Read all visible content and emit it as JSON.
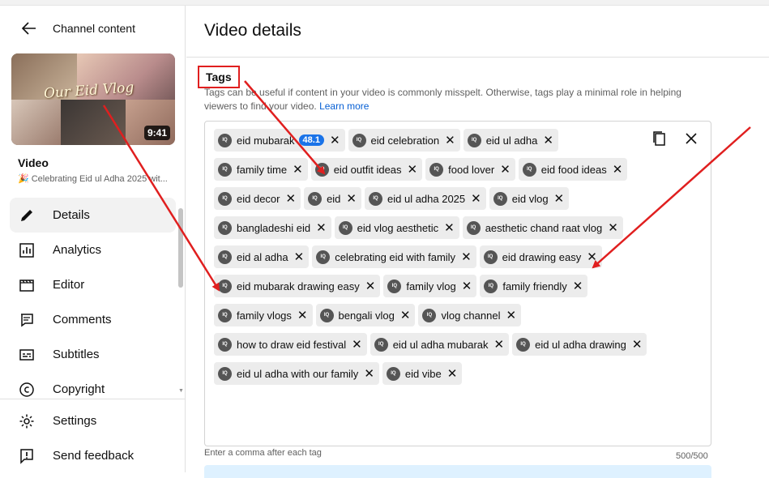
{
  "sidebar": {
    "title": "Channel content",
    "thumbnail": {
      "overlay_text": "Our Eid Vlog",
      "duration": "9:41"
    },
    "video_label": "Video",
    "video_title": "Celebrating Eid ul Adha 2025 wit...",
    "nav": [
      {
        "label": "Details",
        "icon": "pencil-icon",
        "active": true
      },
      {
        "label": "Analytics",
        "icon": "analytics-icon"
      },
      {
        "label": "Editor",
        "icon": "editor-icon"
      },
      {
        "label": "Comments",
        "icon": "comments-icon"
      },
      {
        "label": "Subtitles",
        "icon": "subtitles-icon"
      },
      {
        "label": "Copyright",
        "icon": "copyright-icon"
      }
    ],
    "bottom": [
      {
        "label": "Settings",
        "icon": "gear-icon"
      },
      {
        "label": "Send feedback",
        "icon": "feedback-icon"
      }
    ]
  },
  "main": {
    "title": "Video details",
    "tags_label": "Tags",
    "tags_desc": "Tags can be useful if content in your video is commonly misspelt. Otherwise, tags play a minimal role in helping viewers to find your video.",
    "learn_more": "Learn more",
    "tags": [
      {
        "label": "eid mubarak",
        "score": "48.1"
      },
      {
        "label": "eid celebration"
      },
      {
        "label": "eid ul adha"
      },
      {
        "label": "family time"
      },
      {
        "label": "eid outfit ideas"
      },
      {
        "label": "food lover"
      },
      {
        "label": "eid food ideas"
      },
      {
        "label": "eid decor"
      },
      {
        "label": "eid"
      },
      {
        "label": "eid ul adha 2025"
      },
      {
        "label": "eid vlog"
      },
      {
        "label": "bangladeshi eid"
      },
      {
        "label": "eid vlog aesthetic"
      },
      {
        "label": "aesthetic chand raat vlog"
      },
      {
        "label": "eid al adha"
      },
      {
        "label": "celebrating eid with family"
      },
      {
        "label": "eid drawing easy"
      },
      {
        "label": "eid mubarak drawing easy"
      },
      {
        "label": "family vlog"
      },
      {
        "label": "family friendly"
      },
      {
        "label": "family vlogs"
      },
      {
        "label": "bengali vlog"
      },
      {
        "label": "vlog channel"
      },
      {
        "label": "how to draw eid festival"
      },
      {
        "label": "eid ul adha mubarak"
      },
      {
        "label": "eid ul adha drawing"
      },
      {
        "label": "eid ul adha with our family"
      },
      {
        "label": "eid vibe"
      }
    ],
    "chip_icon_text": "IQ",
    "hint": "Enter a comma after each tag",
    "count": "500/500"
  },
  "colors": {
    "annotation": "#e01f1f",
    "link": "#065fd4",
    "score_badge": "#1a73e8",
    "chip_bg": "#ececec"
  }
}
